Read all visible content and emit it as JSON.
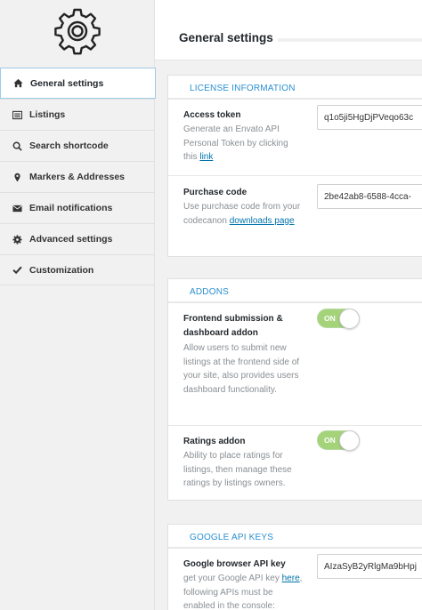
{
  "sidebar": {
    "items": [
      {
        "label": "General settings",
        "icon": "home-icon"
      },
      {
        "label": "Listings",
        "icon": "list-icon"
      },
      {
        "label": "Search shortcode",
        "icon": "search-icon"
      },
      {
        "label": "Markers & Addresses",
        "icon": "map-marker-icon"
      },
      {
        "label": "Email notifications",
        "icon": "envelope-icon"
      },
      {
        "label": "Advanced settings",
        "icon": "gear-icon"
      },
      {
        "label": "Customization",
        "icon": "check-icon"
      }
    ]
  },
  "header": {
    "title": "General settings"
  },
  "license": {
    "title": "LICENSE INFORMATION",
    "access_token": {
      "label": "Access token",
      "desc_before": "Generate an Envato API Personal Token by clicking this ",
      "link": "link",
      "value": "q1o5ji5HgDjPVeqo63c"
    },
    "purchase_code": {
      "label": "Purchase code",
      "desc_before": "Use purchase code from your codecanon ",
      "link": "downloads page",
      "value": "2be42ab8-6588-4cca-"
    }
  },
  "addons": {
    "title": "ADDONS",
    "frontend": {
      "label": "Frontend submission & dashboard addon",
      "desc": "Allow users to submit new listings at the frontend side of your site, also provides users dashboard functionality.",
      "toggle": "ON"
    },
    "ratings": {
      "label": "Ratings addon",
      "desc": "Ability to place ratings for listings, then manage these ratings by listings owners.",
      "toggle": "ON"
    }
  },
  "google": {
    "title": "GOOGLE API KEYS",
    "browser_key": {
      "label": "Google browser API key",
      "desc_before": "get your Google API key ",
      "link": "here",
      "desc_after": ", following APIs must be enabled in the console:",
      "value": "AIzaSyB2yRlgMa9bHpj"
    }
  },
  "colors": {
    "accent": "#2a8fd0",
    "toggle_on": "#a4d37a",
    "active_border": "#9fcbe6"
  }
}
